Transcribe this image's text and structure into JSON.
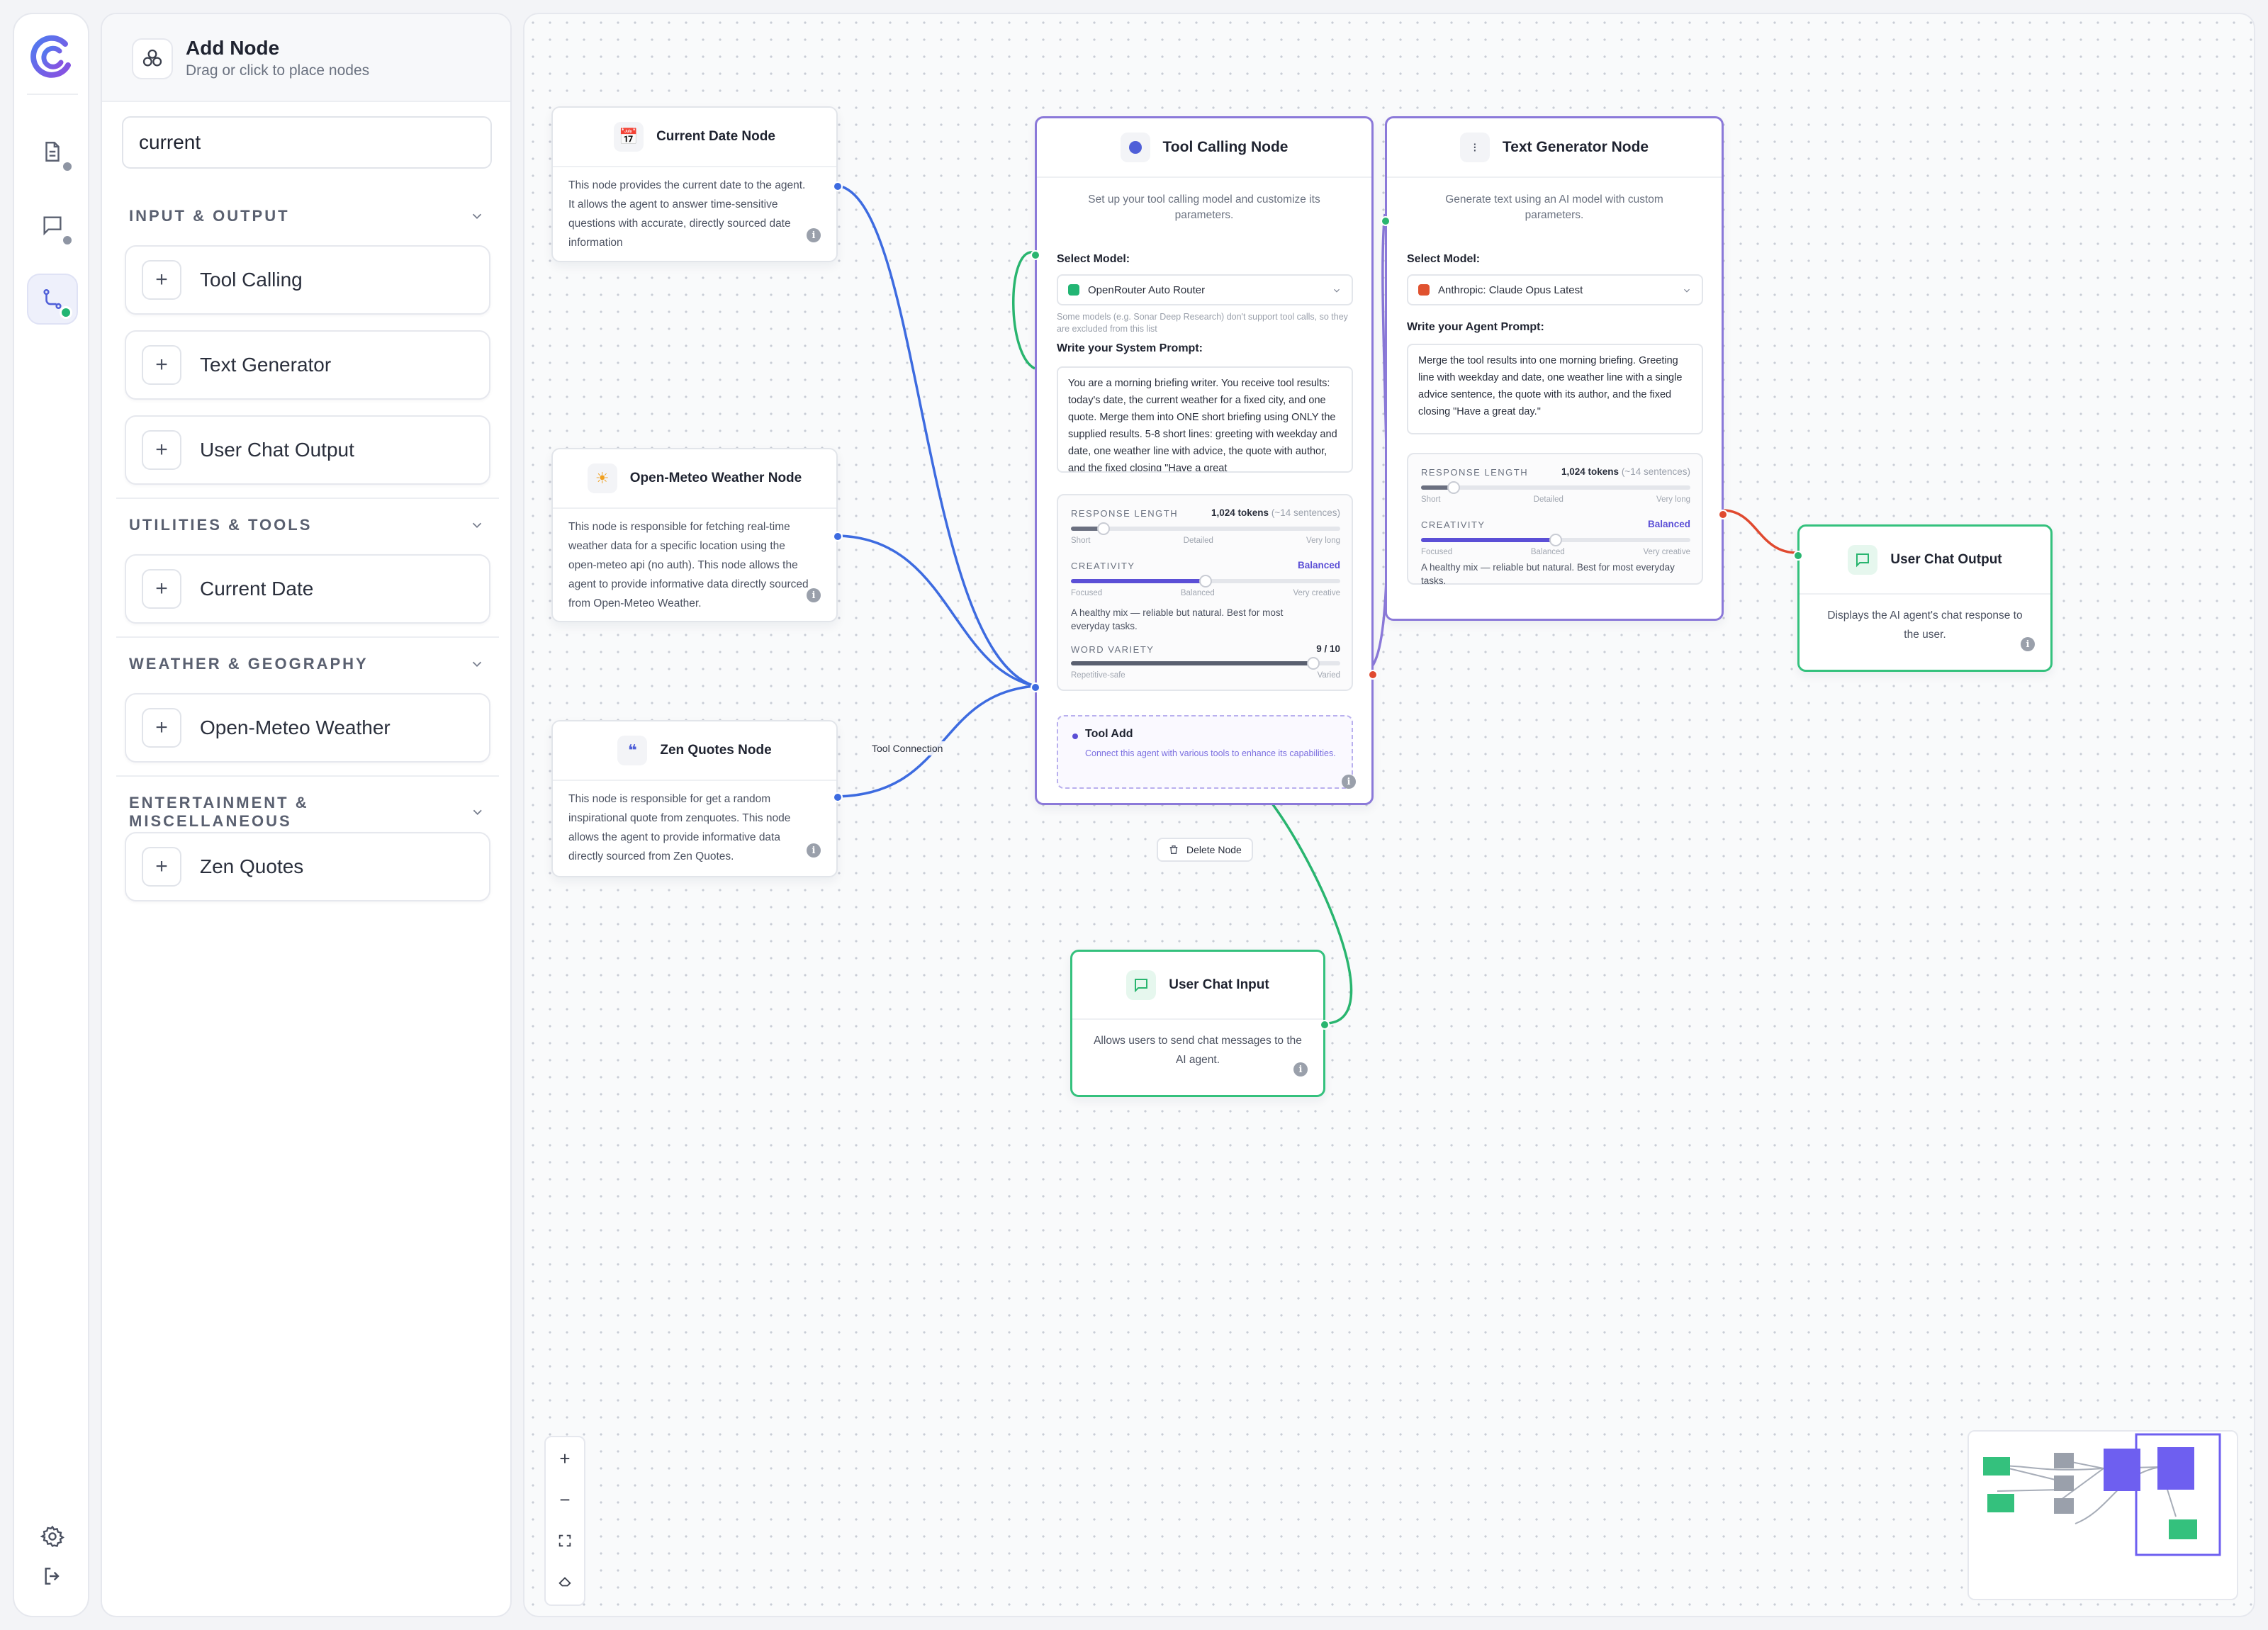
{
  "rail": {
    "icons": [
      "logo-icon",
      "document-icon",
      "chat-icon",
      "flow-icon",
      "settings-icon",
      "logout-icon"
    ]
  },
  "panel": {
    "title": "Add Node",
    "subtitle": "Drag or click to place nodes",
    "search_value": "current",
    "categories": [
      {
        "label": "INPUT & OUTPUT",
        "items": [
          "Tool Calling",
          "Text Generator",
          "User Chat Output"
        ]
      },
      {
        "label": "UTILITIES & TOOLS",
        "items": [
          "Current Date"
        ]
      },
      {
        "label": "WEATHER & GEOGRAPHY",
        "items": [
          "Open-Meteo Weather"
        ]
      },
      {
        "label": "ENTERTAINMENT & MISCELLANEOUS",
        "items": [
          "Zen Quotes"
        ]
      }
    ]
  },
  "nodes": {
    "current_date": {
      "title": "Current Date Node",
      "description": "This node provides the current date to the agent. It allows the agent to answer time-sensitive questions with accurate, directly sourced date information"
    },
    "weather": {
      "title": "Open-Meteo Weather Node",
      "description": "This node is responsible for fetching real-time weather data for a specific location using the open-meteo api (no auth). This node allows the agent to provide informative data directly sourced from Open-Meteo Weather."
    },
    "zen": {
      "title": "Zen Quotes Node",
      "description": "This node is responsible for get a random inspirational quote from zenquotes. This node allows the agent to provide informative data directly sourced from Zen Quotes."
    },
    "tool_calling": {
      "title": "Tool Calling Node",
      "description": "Set up your tool calling model and customize its parameters.",
      "select_model_label": "Select Model:",
      "model": "OpenRouter Auto Router",
      "model_color": "#22b573",
      "model_hint": "Some models (e.g. Sonar Deep Research) don't support tool calls, so they are excluded from this list",
      "prompt_label": "Write your System Prompt:",
      "prompt": "You are a morning briefing writer. You receive tool results: today's date, the current weather for a fixed city, and one quote. Merge them into ONE short briefing using ONLY the supplied results. 5-8 short lines: greeting with weekday and date, one weather line with advice, the quote with author, and the fixed closing \"Have a great",
      "response_length": {
        "label": "RESPONSE LENGTH",
        "value": "1,024 tokens",
        "value_note": "(~14 sentences)",
        "ticks": [
          "Short",
          "Detailed",
          "Very long"
        ],
        "level": 0.12
      },
      "creativity": {
        "label": "CREATIVITY",
        "value": "Balanced",
        "ticks": [
          "Focused",
          "Balanced",
          "Very creative"
        ],
        "level": 0.5,
        "description": "A healthy mix — reliable but natural. Best for most everyday tasks."
      },
      "word_variety": {
        "label": "WORD VARIETY",
        "value": "9 / 10",
        "ticks": [
          "Repetitive-safe",
          "Varied"
        ],
        "level": 0.9
      },
      "tool_add": {
        "title": "Tool Add",
        "description": "Connect this agent with various tools to enhance its capabilities."
      }
    },
    "text_generator": {
      "title": "Text Generator Node",
      "description": "Generate text using an AI model with custom parameters.",
      "select_model_label": "Select Model:",
      "model": "Anthropic: Claude Opus Latest",
      "model_color": "#e0522f",
      "prompt_label": "Write your Agent Prompt:",
      "prompt": "Merge the tool results into one morning briefing. Greeting line with weekday and date, one weather line with a single advice sentence, the quote with its author, and the fixed closing \"Have a great day.\"",
      "response_length": {
        "label": "RESPONSE LENGTH",
        "value": "1,024 tokens",
        "value_note": "(~14 sentences)",
        "ticks": [
          "Short",
          "Detailed",
          "Very long"
        ],
        "level": 0.12
      },
      "creativity": {
        "label": "CREATIVITY",
        "value": "Balanced",
        "ticks": [
          "Focused",
          "Balanced",
          "Very creative"
        ],
        "level": 0.5,
        "description": "A healthy mix — reliable but natural. Best for most everyday tasks."
      }
    },
    "user_chat_output": {
      "title": "User Chat Output",
      "description": "Displays the AI agent's chat response to the user."
    },
    "user_chat_input": {
      "title": "User Chat Input",
      "description": "Allows users to send chat messages to the AI agent."
    }
  },
  "edge_label": "Tool Connection",
  "delete_node_label": "Delete Node",
  "controls": [
    "+",
    "−",
    "fit-view-icon",
    "lock-icon"
  ],
  "colors": {
    "accent": "#5b4fd6",
    "wire_blue": "#3d6be0",
    "wire_green": "#29b56f",
    "wire_red": "#e0492f",
    "wire_purple": "#8b79d9"
  }
}
